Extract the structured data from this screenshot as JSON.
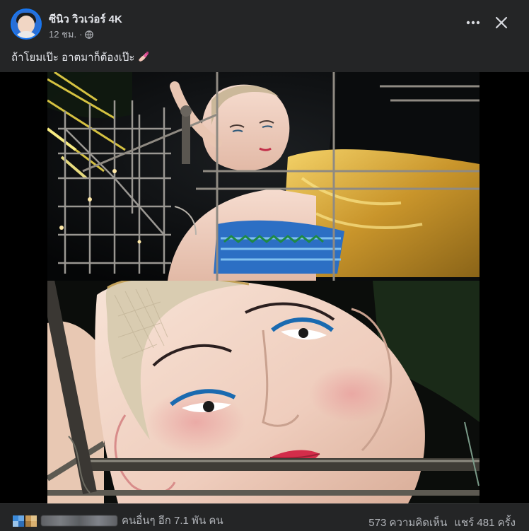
{
  "post": {
    "author": "ซีนิว วิวเว่อร์ 4K",
    "time": "12 ชม.",
    "caption": "ถ้าโยมเป๊ะ อาตมาก็ต้องเป๊ะ"
  },
  "footer": {
    "reactions_text": "คนอื่นๆ อีก 7.1 พัน คน",
    "comments": "573 ความคิดเห็น",
    "shares": "แชร์ 481 ครั้ง"
  },
  "icons": {
    "more": "more-horizontal-icon",
    "close": "close-icon",
    "audience": "globe-icon",
    "emoji": "nail-polish-emoji"
  },
  "colors": {
    "background": "#242526",
    "text_primary": "#e4e6eb",
    "text_secondary": "#b0b3b8",
    "accent": "#1877f2"
  }
}
